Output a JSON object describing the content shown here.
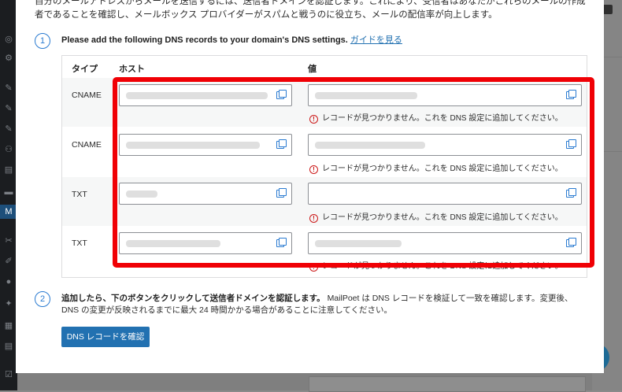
{
  "intro_text": "自分のメールアドレスからメールを送信するには、送信者ドメインを認証します。これにより、受信者はあなたがこれらのメールの作成者であることを確認し、メールボックス プロバイダーがスパムと戦うのに役立ち、メールの配信率が向上します。",
  "step1": {
    "number": "1",
    "instruction": "Please add the following DNS records to your domain's DNS settings.",
    "guide_link": "ガイドを見る"
  },
  "table": {
    "headers": {
      "type": "タイプ",
      "host": "ホスト",
      "value": "値"
    },
    "rows": [
      {
        "type": "CNAME",
        "error": "レコードが見つかりません。これを DNS 設定に追加してください。"
      },
      {
        "type": "CNAME",
        "error": "レコードが見つかりません。これを DNS 設定に追加してください。"
      },
      {
        "type": "TXT",
        "error": "レコードが見つかりません。これを DNS 設定に追加してください。"
      },
      {
        "type": "TXT",
        "error": "レコードが見つかりません。これを DNS 設定に追加してください。"
      }
    ]
  },
  "step2": {
    "number": "2",
    "bold_text": "追加したら、下のボタンをクリックして送信者ドメインを認証します。",
    "body_text": "MailPoet は DNS レコードを検証して一致を確認します。変更後、DNS の変更が反映されるまでに最大 24 時間かかる場合があることに注意してください。"
  },
  "verify_button": "DNS レコードを確認",
  "colors": {
    "accent": "#2271b1",
    "highlight": "#f00005",
    "error": "#cc1818"
  }
}
